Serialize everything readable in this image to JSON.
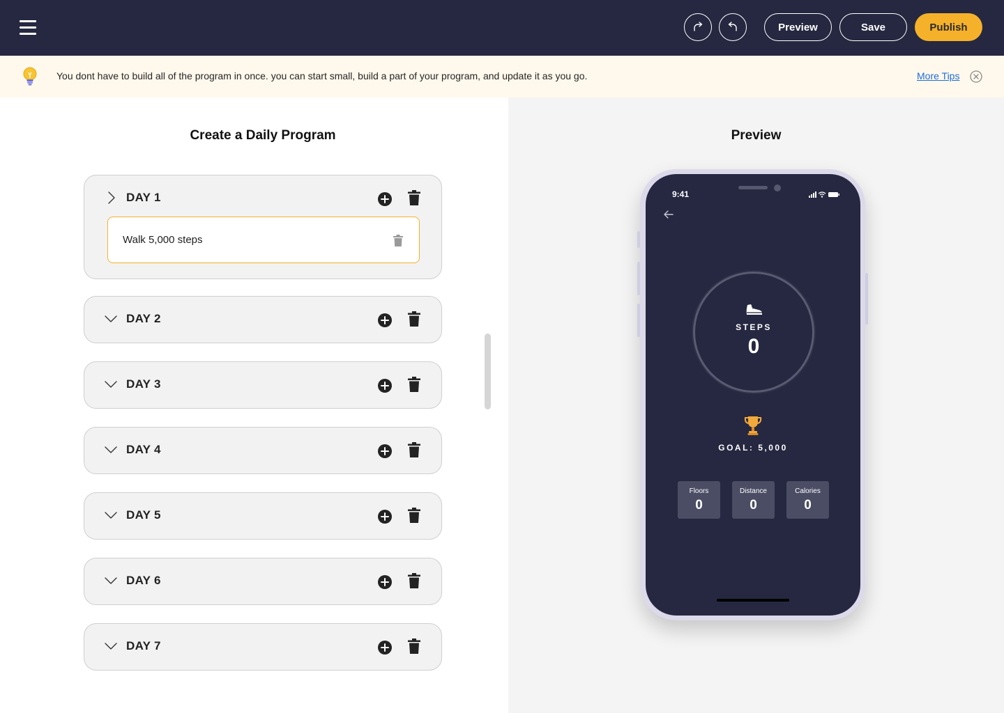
{
  "header": {
    "menu_icon": "hamburger-menu-icon",
    "redo_icon": "redo-icon",
    "undo_icon": "undo-icon",
    "preview_label": "Preview",
    "save_label": "Save",
    "publish_label": "Publish",
    "accent_color": "#f6b12b",
    "background_color": "#252840"
  },
  "tip": {
    "icon": "lightbulb-icon",
    "text": "You dont have to build all of the program in once. you can start small, build a part of your program, and update it as you go.",
    "more_tips_label": "More Tips",
    "close_icon": "close-circle-icon",
    "background_color": "#fff8ec"
  },
  "editor": {
    "title": "Create a Daily Program",
    "days": [
      {
        "label": "DAY 1",
        "expanded": true,
        "tasks": [
          "Walk 5,000 steps"
        ]
      },
      {
        "label": "DAY 2",
        "expanded": false,
        "tasks": []
      },
      {
        "label": "DAY 3",
        "expanded": false,
        "tasks": []
      },
      {
        "label": "DAY 4",
        "expanded": false,
        "tasks": []
      },
      {
        "label": "DAY 5",
        "expanded": false,
        "tasks": []
      },
      {
        "label": "DAY 6",
        "expanded": false,
        "tasks": []
      },
      {
        "label": "DAY 7",
        "expanded": false,
        "tasks": []
      }
    ]
  },
  "preview": {
    "title": "Preview",
    "phone": {
      "time": "9:41",
      "steps_label": "STEPS",
      "steps_value": "0",
      "goal_label": "GOAL: 5,000",
      "stats": [
        {
          "label": "Floors",
          "value": "0"
        },
        {
          "label": "Distance",
          "value": "0"
        },
        {
          "label": "Calories",
          "value": "0"
        }
      ],
      "screen_color": "#252840"
    }
  }
}
